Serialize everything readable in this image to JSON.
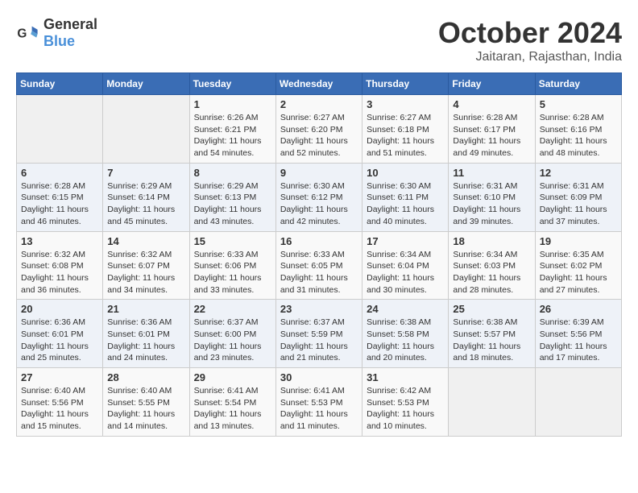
{
  "header": {
    "logo_general": "General",
    "logo_blue": "Blue",
    "month": "October 2024",
    "location": "Jaitaran, Rajasthan, India"
  },
  "weekdays": [
    "Sunday",
    "Monday",
    "Tuesday",
    "Wednesday",
    "Thursday",
    "Friday",
    "Saturday"
  ],
  "weeks": [
    [
      {
        "day": "",
        "sunrise": "",
        "sunset": "",
        "daylight": ""
      },
      {
        "day": "",
        "sunrise": "",
        "sunset": "",
        "daylight": ""
      },
      {
        "day": "1",
        "sunrise": "Sunrise: 6:26 AM",
        "sunset": "Sunset: 6:21 PM",
        "daylight": "Daylight: 11 hours and 54 minutes."
      },
      {
        "day": "2",
        "sunrise": "Sunrise: 6:27 AM",
        "sunset": "Sunset: 6:20 PM",
        "daylight": "Daylight: 11 hours and 52 minutes."
      },
      {
        "day": "3",
        "sunrise": "Sunrise: 6:27 AM",
        "sunset": "Sunset: 6:18 PM",
        "daylight": "Daylight: 11 hours and 51 minutes."
      },
      {
        "day": "4",
        "sunrise": "Sunrise: 6:28 AM",
        "sunset": "Sunset: 6:17 PM",
        "daylight": "Daylight: 11 hours and 49 minutes."
      },
      {
        "day": "5",
        "sunrise": "Sunrise: 6:28 AM",
        "sunset": "Sunset: 6:16 PM",
        "daylight": "Daylight: 11 hours and 48 minutes."
      }
    ],
    [
      {
        "day": "6",
        "sunrise": "Sunrise: 6:28 AM",
        "sunset": "Sunset: 6:15 PM",
        "daylight": "Daylight: 11 hours and 46 minutes."
      },
      {
        "day": "7",
        "sunrise": "Sunrise: 6:29 AM",
        "sunset": "Sunset: 6:14 PM",
        "daylight": "Daylight: 11 hours and 45 minutes."
      },
      {
        "day": "8",
        "sunrise": "Sunrise: 6:29 AM",
        "sunset": "Sunset: 6:13 PM",
        "daylight": "Daylight: 11 hours and 43 minutes."
      },
      {
        "day": "9",
        "sunrise": "Sunrise: 6:30 AM",
        "sunset": "Sunset: 6:12 PM",
        "daylight": "Daylight: 11 hours and 42 minutes."
      },
      {
        "day": "10",
        "sunrise": "Sunrise: 6:30 AM",
        "sunset": "Sunset: 6:11 PM",
        "daylight": "Daylight: 11 hours and 40 minutes."
      },
      {
        "day": "11",
        "sunrise": "Sunrise: 6:31 AM",
        "sunset": "Sunset: 6:10 PM",
        "daylight": "Daylight: 11 hours and 39 minutes."
      },
      {
        "day": "12",
        "sunrise": "Sunrise: 6:31 AM",
        "sunset": "Sunset: 6:09 PM",
        "daylight": "Daylight: 11 hours and 37 minutes."
      }
    ],
    [
      {
        "day": "13",
        "sunrise": "Sunrise: 6:32 AM",
        "sunset": "Sunset: 6:08 PM",
        "daylight": "Daylight: 11 hours and 36 minutes."
      },
      {
        "day": "14",
        "sunrise": "Sunrise: 6:32 AM",
        "sunset": "Sunset: 6:07 PM",
        "daylight": "Daylight: 11 hours and 34 minutes."
      },
      {
        "day": "15",
        "sunrise": "Sunrise: 6:33 AM",
        "sunset": "Sunset: 6:06 PM",
        "daylight": "Daylight: 11 hours and 33 minutes."
      },
      {
        "day": "16",
        "sunrise": "Sunrise: 6:33 AM",
        "sunset": "Sunset: 6:05 PM",
        "daylight": "Daylight: 11 hours and 31 minutes."
      },
      {
        "day": "17",
        "sunrise": "Sunrise: 6:34 AM",
        "sunset": "Sunset: 6:04 PM",
        "daylight": "Daylight: 11 hours and 30 minutes."
      },
      {
        "day": "18",
        "sunrise": "Sunrise: 6:34 AM",
        "sunset": "Sunset: 6:03 PM",
        "daylight": "Daylight: 11 hours and 28 minutes."
      },
      {
        "day": "19",
        "sunrise": "Sunrise: 6:35 AM",
        "sunset": "Sunset: 6:02 PM",
        "daylight": "Daylight: 11 hours and 27 minutes."
      }
    ],
    [
      {
        "day": "20",
        "sunrise": "Sunrise: 6:36 AM",
        "sunset": "Sunset: 6:01 PM",
        "daylight": "Daylight: 11 hours and 25 minutes."
      },
      {
        "day": "21",
        "sunrise": "Sunrise: 6:36 AM",
        "sunset": "Sunset: 6:01 PM",
        "daylight": "Daylight: 11 hours and 24 minutes."
      },
      {
        "day": "22",
        "sunrise": "Sunrise: 6:37 AM",
        "sunset": "Sunset: 6:00 PM",
        "daylight": "Daylight: 11 hours and 23 minutes."
      },
      {
        "day": "23",
        "sunrise": "Sunrise: 6:37 AM",
        "sunset": "Sunset: 5:59 PM",
        "daylight": "Daylight: 11 hours and 21 minutes."
      },
      {
        "day": "24",
        "sunrise": "Sunrise: 6:38 AM",
        "sunset": "Sunset: 5:58 PM",
        "daylight": "Daylight: 11 hours and 20 minutes."
      },
      {
        "day": "25",
        "sunrise": "Sunrise: 6:38 AM",
        "sunset": "Sunset: 5:57 PM",
        "daylight": "Daylight: 11 hours and 18 minutes."
      },
      {
        "day": "26",
        "sunrise": "Sunrise: 6:39 AM",
        "sunset": "Sunset: 5:56 PM",
        "daylight": "Daylight: 11 hours and 17 minutes."
      }
    ],
    [
      {
        "day": "27",
        "sunrise": "Sunrise: 6:40 AM",
        "sunset": "Sunset: 5:56 PM",
        "daylight": "Daylight: 11 hours and 15 minutes."
      },
      {
        "day": "28",
        "sunrise": "Sunrise: 6:40 AM",
        "sunset": "Sunset: 5:55 PM",
        "daylight": "Daylight: 11 hours and 14 minutes."
      },
      {
        "day": "29",
        "sunrise": "Sunrise: 6:41 AM",
        "sunset": "Sunset: 5:54 PM",
        "daylight": "Daylight: 11 hours and 13 minutes."
      },
      {
        "day": "30",
        "sunrise": "Sunrise: 6:41 AM",
        "sunset": "Sunset: 5:53 PM",
        "daylight": "Daylight: 11 hours and 11 minutes."
      },
      {
        "day": "31",
        "sunrise": "Sunrise: 6:42 AM",
        "sunset": "Sunset: 5:53 PM",
        "daylight": "Daylight: 11 hours and 10 minutes."
      },
      {
        "day": "",
        "sunrise": "",
        "sunset": "",
        "daylight": ""
      },
      {
        "day": "",
        "sunrise": "",
        "sunset": "",
        "daylight": ""
      }
    ]
  ]
}
